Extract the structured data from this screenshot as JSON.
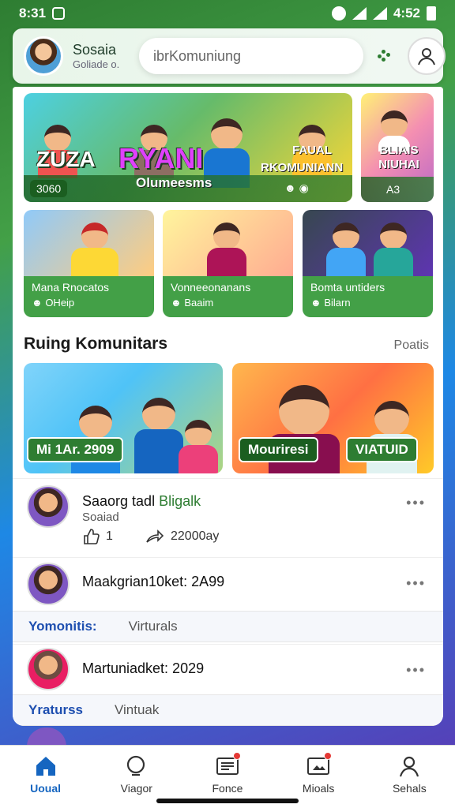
{
  "status_bar": {
    "time": "8:31",
    "right_time": "4:52"
  },
  "header": {
    "user_name": "Sosaia",
    "user_sub": "Goliade o.",
    "search_placeholder": "ibrKomuniung"
  },
  "banners": [
    {
      "title": "RYANI",
      "left_title": "ZUZA",
      "sub": "Olumeesms",
      "right_label": "RKOMUNIANN",
      "right_top": "FAUAL",
      "chip": "3060",
      "small_icons": "☻ ◉"
    },
    {
      "title": "BLIAIS NIUHAI",
      "chip": "A3"
    }
  ],
  "categories": [
    {
      "title": "Mana Rnocatos",
      "sub": "OHeip",
      "sub_icon": "☻"
    },
    {
      "title": "Vonneeonanans",
      "sub": "Baaim",
      "sub_icon": "☻"
    },
    {
      "title": "Bomta untiders",
      "sub": "Bilarn",
      "sub_icon": "☻"
    }
  ],
  "section": {
    "title": "Ruing Komunitars",
    "link": "Poatis"
  },
  "tiles": [
    {
      "label": "Mi 1Ar. 2909"
    },
    {
      "label_left": "Mouriresi",
      "label_right": "VIATUID"
    }
  ],
  "feed": [
    {
      "title_main": "Saaorg tadl ",
      "title_highlight": "Bligalk",
      "sub": "Soaiad",
      "like_count": "1",
      "share_text": "22000ay"
    },
    {
      "title": "Maakgrian10ket: 2A99"
    },
    {
      "tabs": [
        "Yomonitis:",
        "Virturals"
      ]
    },
    {
      "title": "Martuniadket: 2029"
    },
    {
      "tabs": [
        "Yraturss",
        "Vintuak"
      ]
    }
  ],
  "bottom_nav": [
    {
      "label": "Uoual",
      "icon": "home-icon",
      "active": true
    },
    {
      "label": "Viagor",
      "icon": "search-icon",
      "active": false
    },
    {
      "label": "Fonce",
      "icon": "news-icon",
      "active": false,
      "badge": true
    },
    {
      "label": "Mioals",
      "icon": "media-icon",
      "active": false,
      "badge": true
    },
    {
      "label": "Sehals",
      "icon": "person-icon",
      "active": false
    }
  ],
  "colors": {
    "brand_green": "#2e7d32",
    "accent_blue": "#1565c0",
    "badge_red": "#e53935"
  }
}
